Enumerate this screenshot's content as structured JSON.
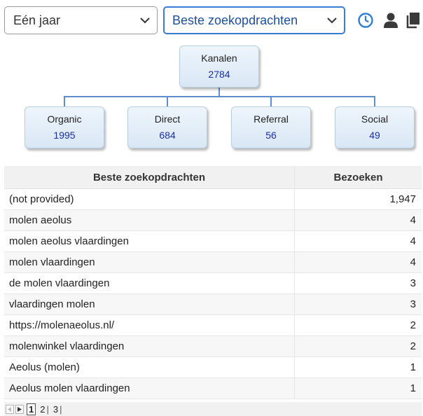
{
  "filters": {
    "period": "Eén jaar",
    "report": "Beste zoekopdrachten"
  },
  "toolbar": {
    "icons": [
      "clock-icon",
      "person-icon",
      "copy-icon"
    ],
    "accent": "#3a7bd5"
  },
  "channels": {
    "root": {
      "label": "Kanalen",
      "value": "2784"
    },
    "children": [
      {
        "label": "Organic",
        "value": "1995"
      },
      {
        "label": "Direct",
        "value": "684"
      },
      {
        "label": "Referral",
        "value": "56"
      },
      {
        "label": "Social",
        "value": "49"
      }
    ]
  },
  "table": {
    "headers": [
      "Beste zoekopdrachten",
      "Bezoeken"
    ],
    "rows": [
      {
        "query": "(not provided)",
        "visits": "1,947"
      },
      {
        "query": "molen aeolus",
        "visits": "4"
      },
      {
        "query": "molen aeolus vlaardingen",
        "visits": "4"
      },
      {
        "query": "molen vlaardingen",
        "visits": "4"
      },
      {
        "query": "de molen vlaardingen",
        "visits": "3"
      },
      {
        "query": "vlaardingen molen",
        "visits": "3"
      },
      {
        "query": "https://molenaeolus.nl/",
        "visits": "2"
      },
      {
        "query": "molenwinkel vlaardingen",
        "visits": "2"
      },
      {
        "query": "Aeolus (molen)",
        "visits": "1"
      },
      {
        "query": "Aeolus molen vlaardingen",
        "visits": "1"
      }
    ]
  },
  "pager": {
    "pages": [
      "1",
      "2",
      "3"
    ],
    "current": "1"
  }
}
